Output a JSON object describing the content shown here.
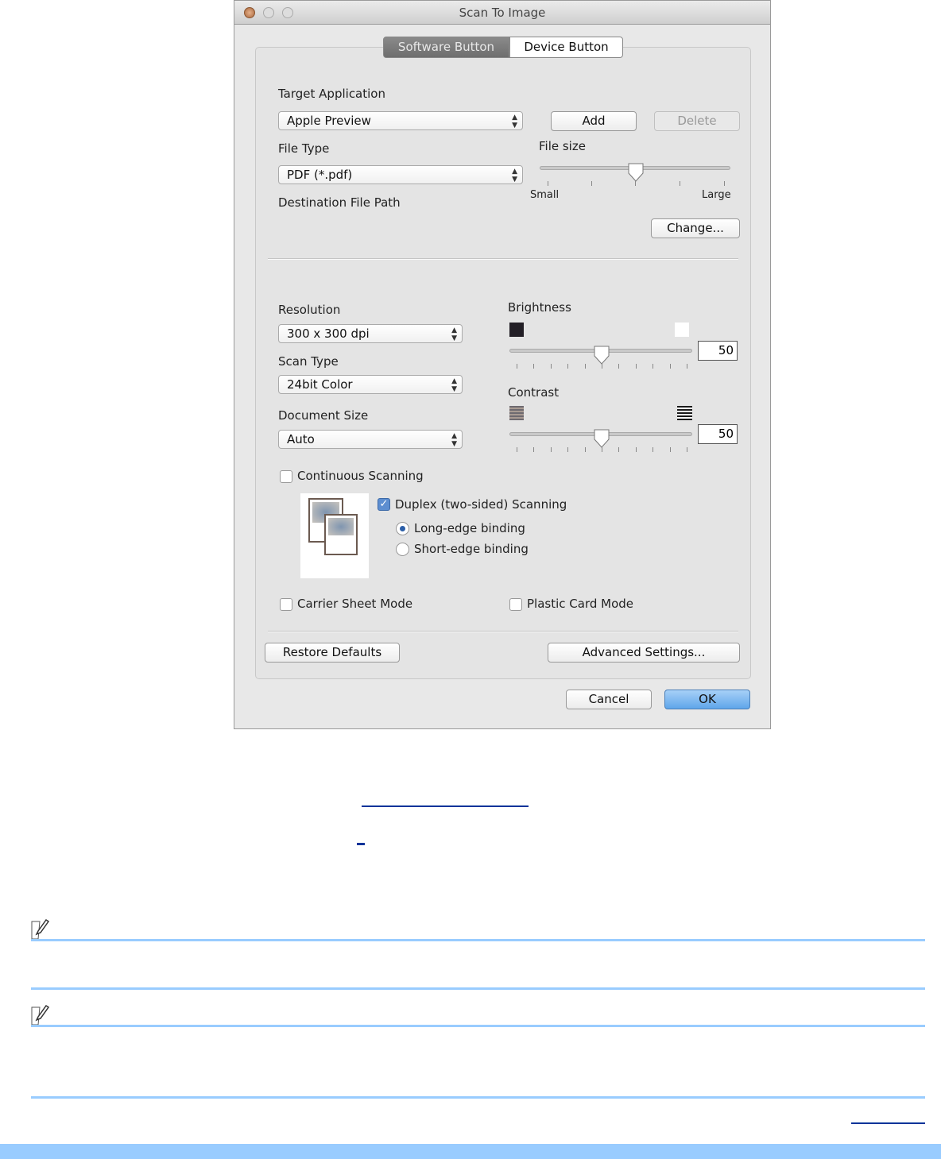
{
  "dialog": {
    "title": "Scan To Image",
    "tabs": [
      {
        "label": "Software Button",
        "selected": true
      },
      {
        "label": "Device Button",
        "selected": false
      }
    ],
    "target_application": {
      "label": "Target Application",
      "value": "Apple Preview",
      "add": "Add",
      "delete": "Delete"
    },
    "file_type": {
      "label": "File Type",
      "value": "PDF (*.pdf)"
    },
    "file_size": {
      "label": "File size",
      "min_label": "Small",
      "max_label": "Large",
      "value_fraction": 0.5
    },
    "destination": {
      "label": "Destination File Path",
      "change": "Change..."
    },
    "resolution": {
      "label": "Resolution",
      "value": "300 x 300 dpi"
    },
    "scan_type": {
      "label": "Scan Type",
      "value": "24bit Color"
    },
    "document_size": {
      "label": "Document Size",
      "value": "Auto"
    },
    "brightness": {
      "label": "Brightness",
      "value": "50"
    },
    "contrast": {
      "label": "Contrast",
      "value": "50"
    },
    "continuous": {
      "label": "Continuous Scanning",
      "checked": false
    },
    "duplex": {
      "label": "Duplex (two-sided) Scanning",
      "checked": true,
      "long_edge": "Long-edge binding",
      "short_edge": "Short-edge binding",
      "selected": "long"
    },
    "carrier": {
      "label": "Carrier Sheet Mode",
      "checked": false
    },
    "plastic": {
      "label": "Plastic Card Mode",
      "checked": false
    },
    "restore": "Restore Defaults",
    "advanced": "Advanced Settings...",
    "cancel": "Cancel",
    "ok": "OK"
  },
  "colors": {
    "rule": "#99ccff",
    "link": "#003399",
    "ok": "#6fb0ee"
  }
}
